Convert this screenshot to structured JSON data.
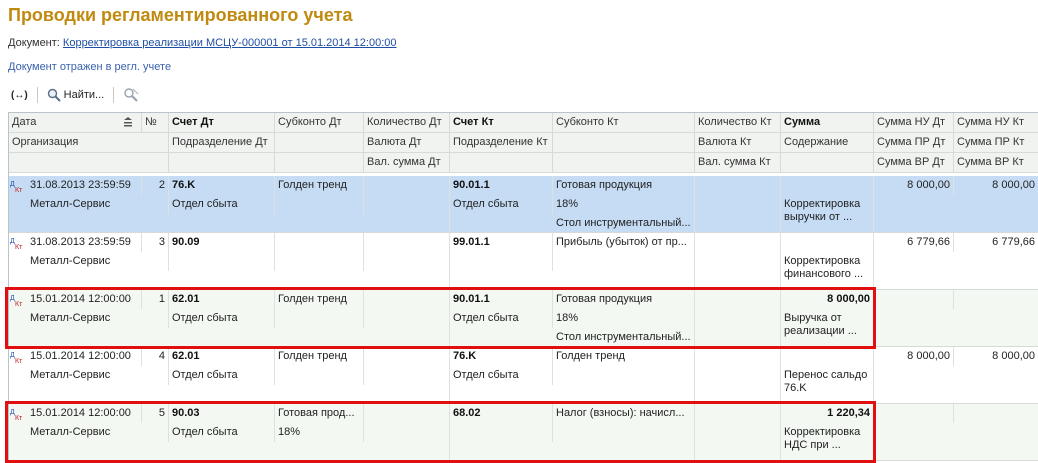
{
  "page": {
    "title": "Проводки регламентированного учета",
    "doc_label": "Документ:",
    "doc_link": "Корректировка реализации МСЦУ-000001 от 15.01.2014 12:00:00",
    "reflected_text": "Документ отражен в регл. учете"
  },
  "toolbar": {
    "expand_label": "(↔)",
    "find_label": "Найти...",
    "cancel_search_label": ""
  },
  "header": {
    "row1": {
      "date": "Дата",
      "num": "№",
      "acc_dt": "Счет Дт",
      "sub_dt": "Субконто Дт",
      "qty_dt": "Количество Дт",
      "acc_kt": "Счет Кт",
      "sub_kt": "Субконто Кт",
      "qty_kt": "Количество Кт",
      "sum": "Сумма",
      "sum_nu_dt": "Сумма НУ Дт",
      "sum_nu_kt": "Сумма НУ Кт"
    },
    "row2": {
      "org": "Организация",
      "dept_dt": "Подразделение Дт",
      "cur_dt": "Валюта Дт",
      "dept_kt": "Подразделение Кт",
      "cur_kt": "Валюта Кт",
      "content": "Содержание",
      "sum_pr_dt": "Сумма ПР Дт",
      "sum_pr_kt": "Сумма ПР Кт"
    },
    "row3": {
      "cur_sum_dt": "Вал. сумма Дт",
      "cur_sum_kt": "Вал. сумма Кт",
      "sum_vr_dt": "Сумма ВР Дт",
      "sum_vr_kt": "Сумма ВР Кт"
    }
  },
  "rows": [
    {
      "date": "31.08.2013 23:59:59",
      "num": "2",
      "org": "Металл-Сервис",
      "acc_dt": "76.K",
      "dept_dt": "Отдел сбыта",
      "sub_dt1": "Голден тренд",
      "sub_dt2": "",
      "acc_kt": "90.01.1",
      "dept_kt": "Отдел сбыта",
      "sub_kt1": "Готовая продукция",
      "sub_kt2": "18%",
      "sub_kt3": "Стол инструментальный...",
      "sum": "",
      "content": "Корректировка выручки от ...",
      "sum_nu_dt": "8 000,00",
      "sum_nu_kt": "8 000,00"
    },
    {
      "date": "31.08.2013 23:59:59",
      "num": "3",
      "org": "Металл-Сервис",
      "acc_dt": "90.09",
      "dept_dt": "",
      "sub_dt1": "",
      "sub_dt2": "",
      "acc_kt": "99.01.1",
      "dept_kt": "",
      "sub_kt1": "Прибыль (убыток) от пр...",
      "sub_kt2": "",
      "sub_kt3": "",
      "sum": "",
      "content": "Корректировка финансового ...",
      "sum_nu_dt": "6 779,66",
      "sum_nu_kt": "6 779,66"
    },
    {
      "date": "15.01.2014 12:00:00",
      "num": "1",
      "org": "Металл-Сервис",
      "acc_dt": "62.01",
      "dept_dt": "Отдел сбыта",
      "sub_dt1": "Голден тренд",
      "sub_dt2": "",
      "acc_kt": "90.01.1",
      "dept_kt": "Отдел сбыта",
      "sub_kt1": "Готовая продукция",
      "sub_kt2": "18%",
      "sub_kt3": "Стол инструментальный...",
      "sum": "8 000,00",
      "content": "Выручка от реализации ...",
      "sum_nu_dt": "",
      "sum_nu_kt": ""
    },
    {
      "date": "15.01.2014 12:00:00",
      "num": "4",
      "org": "Металл-Сервис",
      "acc_dt": "62.01",
      "dept_dt": "Отдел сбыта",
      "sub_dt1": "Голден тренд",
      "sub_dt2": "",
      "acc_kt": "76.K",
      "dept_kt": "Отдел сбыта",
      "sub_kt1": "Голден тренд",
      "sub_kt2": "",
      "sub_kt3": "",
      "sum": "",
      "content": "Перенос сальдо 76.K",
      "sum_nu_dt": "8 000,00",
      "sum_nu_kt": "8 000,00"
    },
    {
      "date": "15.01.2014 12:00:00",
      "num": "5",
      "org": "Металл-Сервис",
      "acc_dt": "90.03",
      "dept_dt": "Отдел сбыта",
      "sub_dt1": "Готовая прод...",
      "sub_dt2": "18%",
      "acc_kt": "68.02",
      "dept_kt": "",
      "sub_kt1": "Налог (взносы): начисл...",
      "sub_kt2": "",
      "sub_kt3": "",
      "sum": "1 220,34",
      "content": "Корректировка НДС при ...",
      "sum_nu_dt": "",
      "sum_nu_kt": ""
    }
  ],
  "colors": {
    "title": "#c08a10",
    "selected_row": "#c5dcf4",
    "alt_row": "#f3f8f2",
    "highlight_box": "#e01010"
  }
}
